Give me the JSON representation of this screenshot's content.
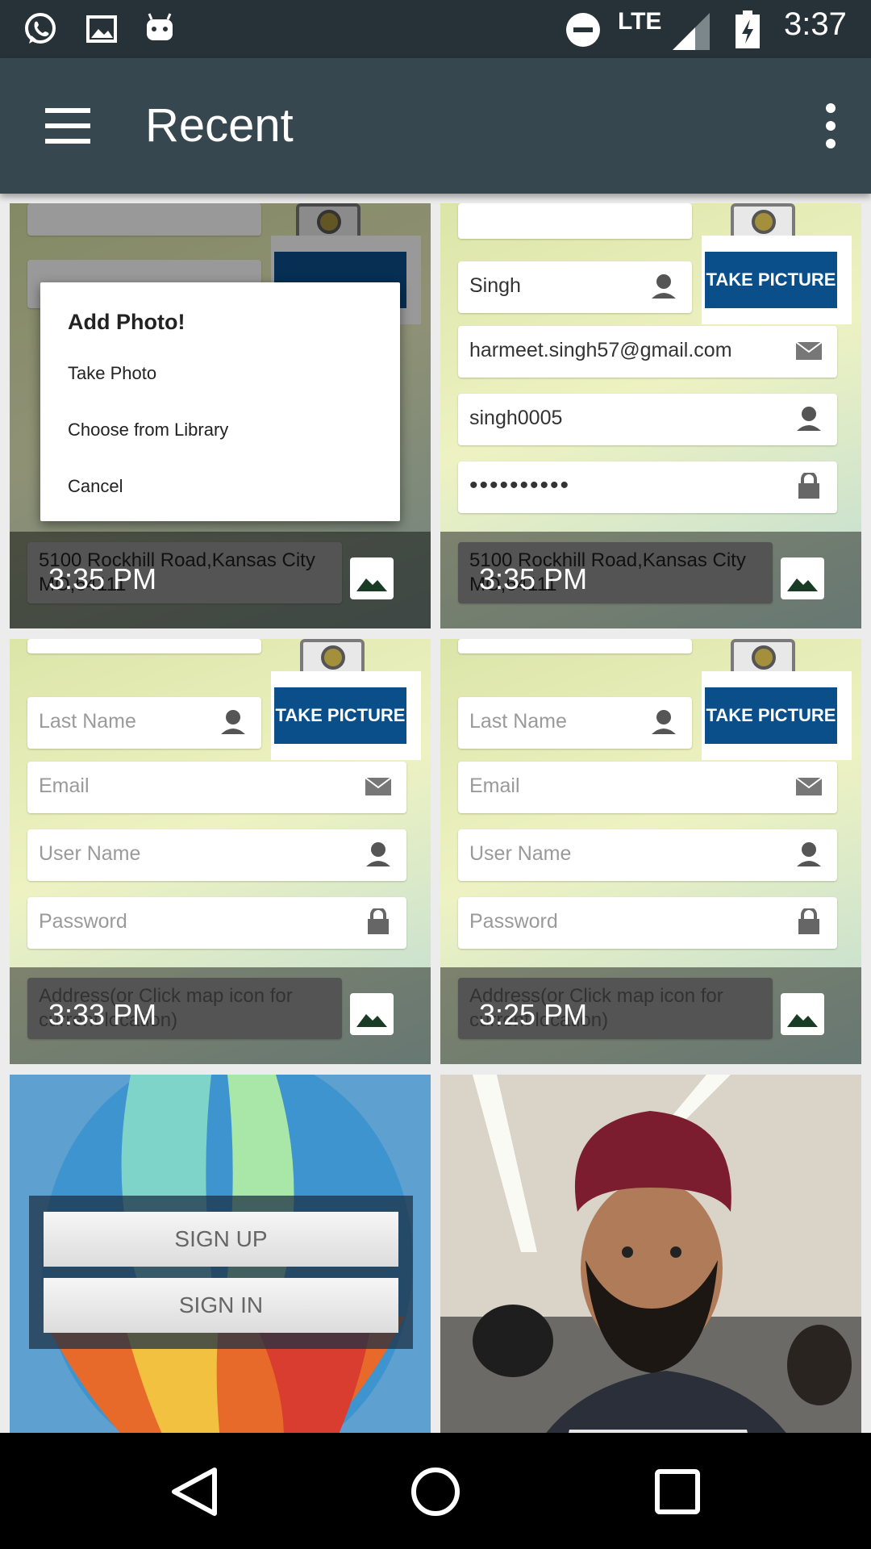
{
  "status_bar": {
    "time": "3:37",
    "network": "LTE",
    "icons": [
      "whatsapp-icon",
      "image-notification-icon",
      "android-icon",
      "do-not-disturb-icon",
      "signal-icon",
      "battery-charging-icon"
    ]
  },
  "toolbar": {
    "title": "Recent",
    "menu_icon": "hamburger-menu-icon",
    "overflow_icon": "more-vert-icon",
    "color": "#37474f"
  },
  "tiles": [
    {
      "time": "3:35 PM",
      "dialog": {
        "title": "Add Photo!",
        "items": [
          "Take Photo",
          "Choose from Library",
          "Cancel"
        ]
      },
      "address": "5100 Rockhill Road,Kansas City MO,64111"
    },
    {
      "time": "3:35 PM",
      "fields": [
        "Singh",
        "harmeet.singh57@gmail.com",
        "singh0005",
        "••••••••••"
      ],
      "button": "TAKE PICTURE",
      "address": "5100 Rockhill Road,Kansas City MO,64111"
    },
    {
      "time": "3:33 PM",
      "fields": [
        "Last Name",
        "Email",
        "User Name",
        "Password"
      ],
      "button": "TAKE PICTURE",
      "address": "Address(or Click map icon for current location)"
    },
    {
      "time": "3:25 PM",
      "fields": [
        "Last Name",
        "Email",
        "User Name",
        "Password"
      ],
      "button": "TAKE PICTURE",
      "address": "Address(or Click map icon for current location)"
    },
    {
      "buttons": [
        "SIGN UP",
        "SIGN IN"
      ]
    },
    {
      "type": "selfie-photo"
    }
  ],
  "navbar": {
    "back_icon": "back-icon",
    "home_icon": "home-icon",
    "recents_icon": "recents-icon"
  }
}
